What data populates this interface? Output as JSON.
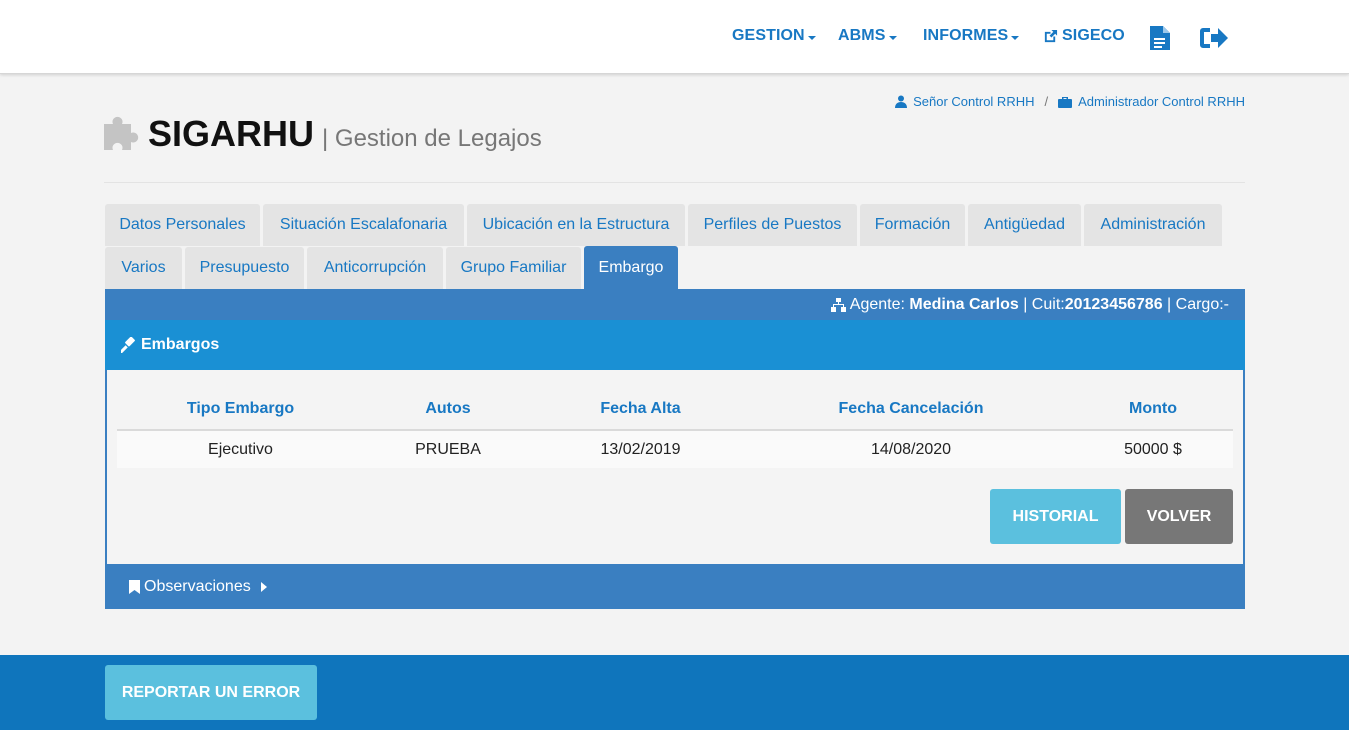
{
  "nav": {
    "gestion": "GESTION",
    "abms": "ABMS",
    "informes": "INFORMES",
    "sigeco": "SIGECO",
    "icons": [
      "external-link-icon",
      "document-icon",
      "sign-out-icon"
    ]
  },
  "header": {
    "user": "Señor Control RRHH",
    "separator": "/",
    "role": "Administrador Control RRHH",
    "title": "SIGARHU",
    "subtitle": "| Gestion de Legajos"
  },
  "tabs": {
    "row1": [
      "Datos Personales",
      "Situación Escalafonaria",
      "Ubicación en la Estructura",
      "Perfiles de Puestos",
      "Formación",
      "Antigüedad",
      "Administración"
    ],
    "row2": [
      "Varios",
      "Presupuesto",
      "Anticorrupción",
      "Grupo Familiar",
      "Embargo"
    ],
    "active": "Embargo"
  },
  "agent": {
    "agent_label": "Agente:",
    "agent_name": "Medina Carlos",
    "cuit_label": "| Cuit:",
    "cuit": "20123456786",
    "cargo_label": "| Cargo:-"
  },
  "panel": {
    "title": "Embargos",
    "columns": [
      "Tipo Embargo",
      "Autos",
      "Fecha Alta",
      "Fecha Cancelación",
      "Monto"
    ],
    "rows": [
      [
        "Ejecutivo",
        "PRUEBA",
        "13/02/2019",
        "14/08/2020",
        "50000 $"
      ]
    ],
    "historial_button": "HISTORIAL",
    "volver_button": "VOLVER"
  },
  "observaciones": {
    "label": "Observaciones"
  },
  "footer": {
    "report_button": "REPORTAR UN ERROR"
  },
  "colors": {
    "primary": "#1878c3",
    "tab_active": "#3a7fc1",
    "panel_header": "#1a90d4",
    "info_button": "#5bc0de",
    "default_button": "#777777",
    "footer": "#0f75bc"
  }
}
